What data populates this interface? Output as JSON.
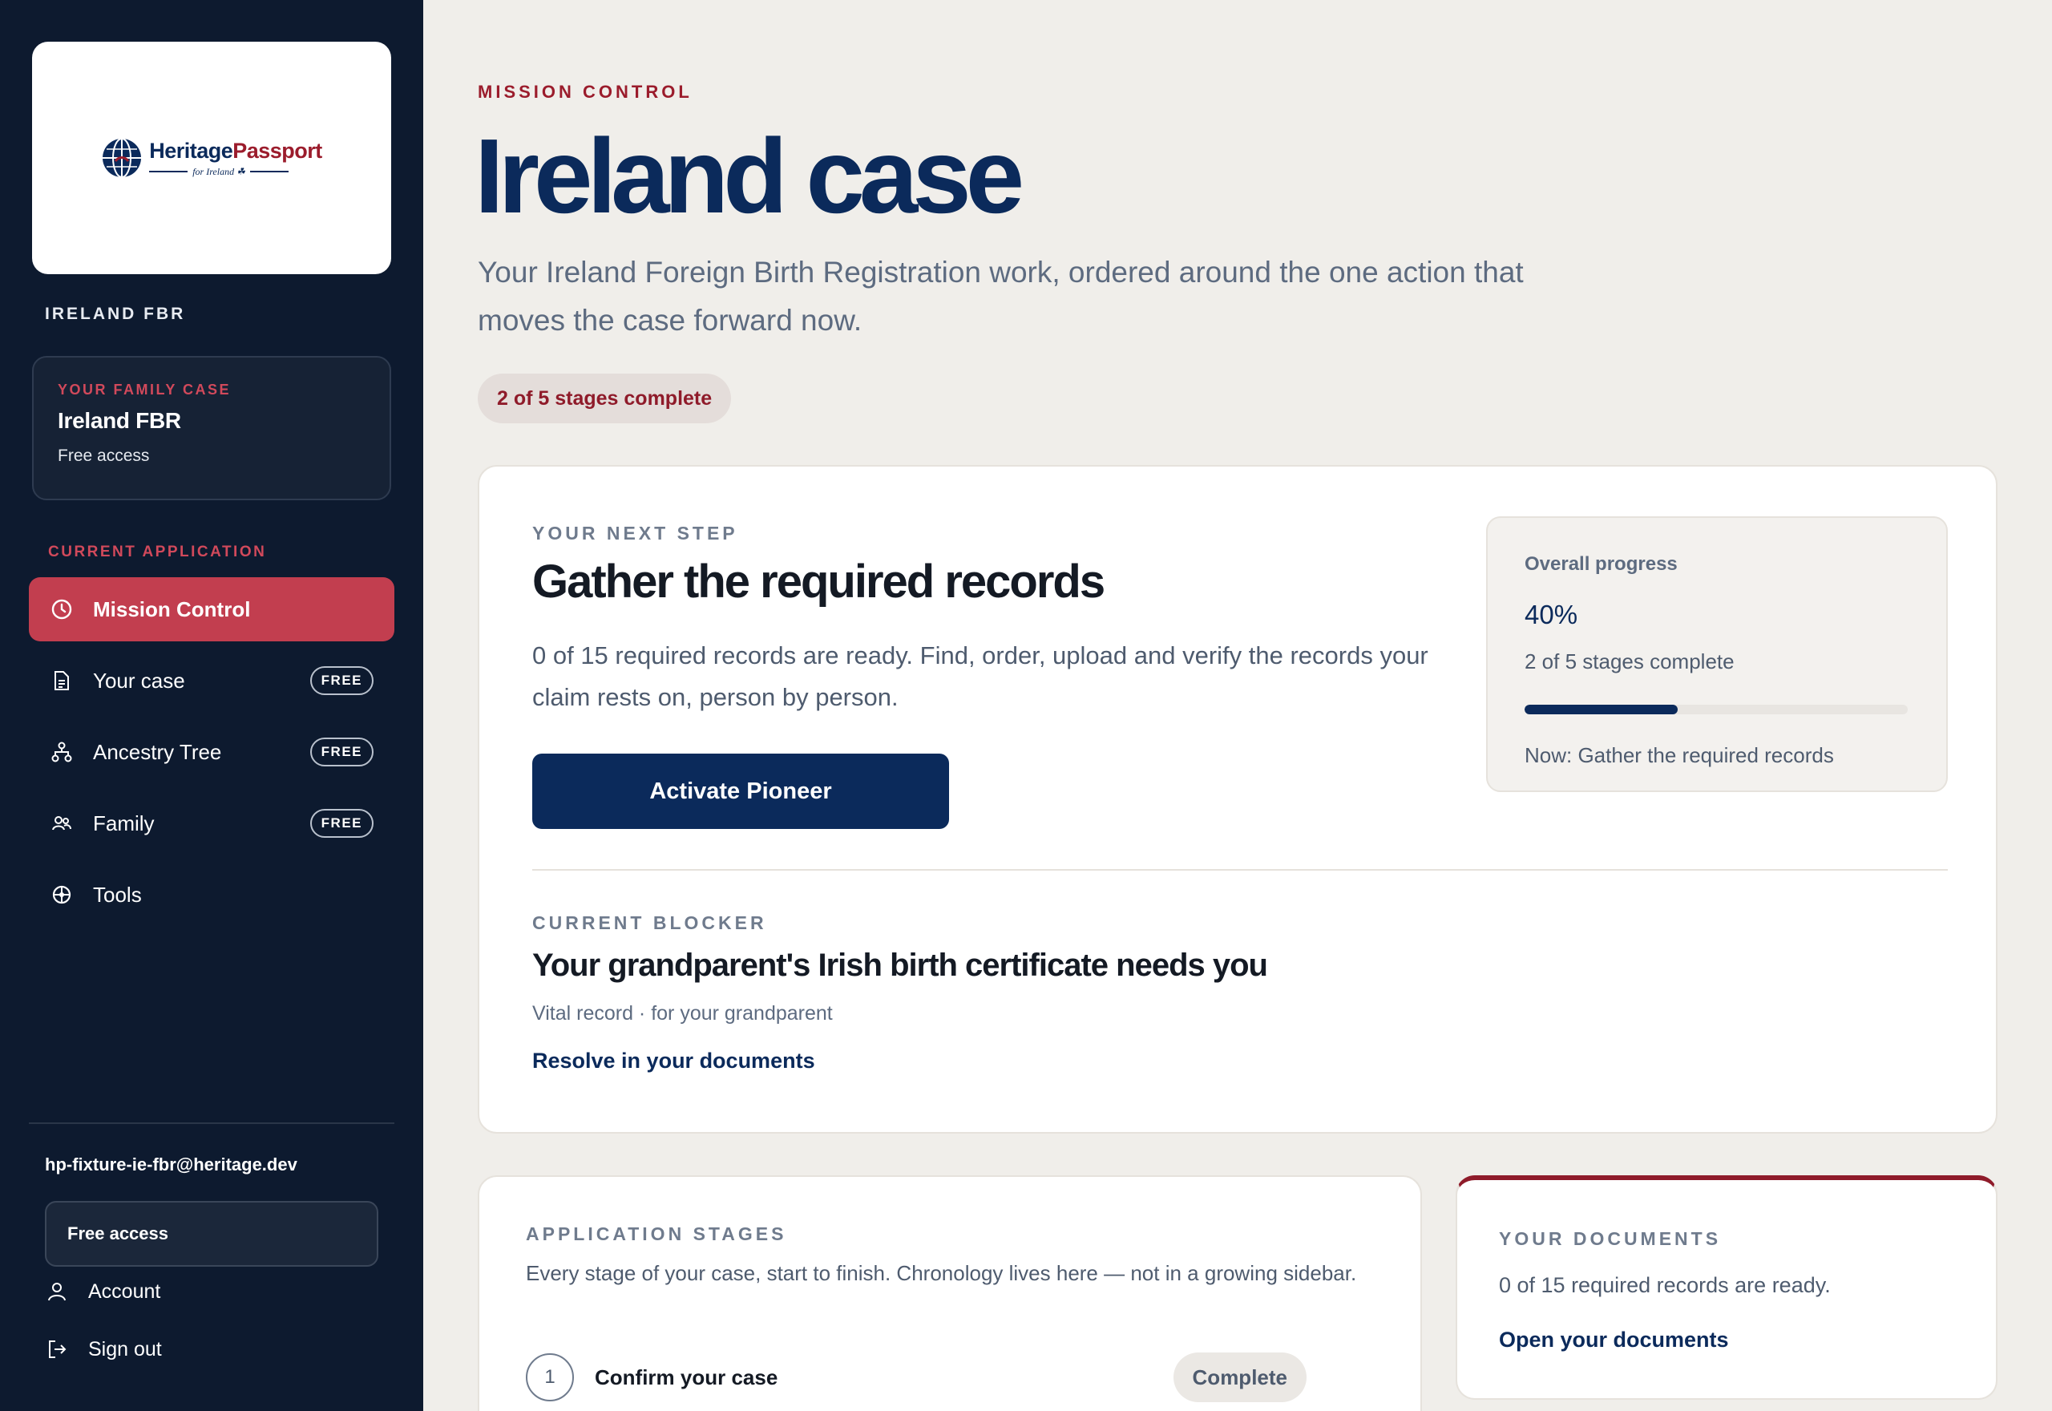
{
  "brand": {
    "logo_word1": "Heritage",
    "logo_word2": "Passport",
    "logo_sub": "for Ireland ☘",
    "colors": {
      "navy": "#0b2a5b",
      "crimson": "#9b1c2c",
      "sidebar": "#0d1a2f",
      "active": "#c23e4f"
    }
  },
  "sidebar": {
    "product_label": "IRELAND FBR",
    "family_case": {
      "label": "YOUR FAMILY CASE",
      "title": "Ireland FBR",
      "access": "Free access"
    },
    "section_label": "CURRENT APPLICATION",
    "items": [
      {
        "label": "Mission Control",
        "icon": "clock-icon",
        "badge": "",
        "active": true
      },
      {
        "label": "Your case",
        "icon": "document-icon",
        "badge": "FREE",
        "active": false
      },
      {
        "label": "Ancestry Tree",
        "icon": "tree-icon",
        "badge": "FREE",
        "active": false
      },
      {
        "label": "Family",
        "icon": "people-icon",
        "badge": "FREE",
        "active": false
      },
      {
        "label": "Tools",
        "icon": "tools-icon",
        "badge": "",
        "active": false
      }
    ],
    "user_email": "hp-fixture-ie-fbr@heritage.dev",
    "plan_button": "Free access",
    "account_label": "Account",
    "signout_label": "Sign out"
  },
  "header": {
    "eyebrow": "MISSION CONTROL",
    "title": "Ireland case",
    "description": "Your Ireland Foreign Birth Registration work, ordered around the one action that moves the case forward now.",
    "stage_pill": "2 of 5 stages complete"
  },
  "next_step": {
    "label": "YOUR NEXT STEP",
    "title": "Gather the required records",
    "description": "0 of 15 required records are ready. Find, order, upload and verify the records your claim rests on, person by person.",
    "button_label": "Activate Pioneer"
  },
  "progress": {
    "label": "Overall progress",
    "value_text": "40%",
    "fraction": 0.4,
    "stages_text": "2 of 5 stages complete",
    "now_text": "Now: Gather the required records"
  },
  "blocker": {
    "label": "CURRENT BLOCKER",
    "title": "Your grandparent's Irish birth certificate needs you",
    "subtitle": "Vital record · for your grandparent",
    "link": "Resolve in your documents"
  },
  "stages": {
    "label": "APPLICATION STAGES",
    "description": "Every stage of your case, start to finish. Chronology lives here — not in a growing sidebar.",
    "rows": [
      {
        "number": "1",
        "name": "Confirm your case",
        "status": "Complete"
      }
    ]
  },
  "documents": {
    "label": "YOUR DOCUMENTS",
    "description": "0 of 15 required records are ready.",
    "link": "Open your documents"
  }
}
